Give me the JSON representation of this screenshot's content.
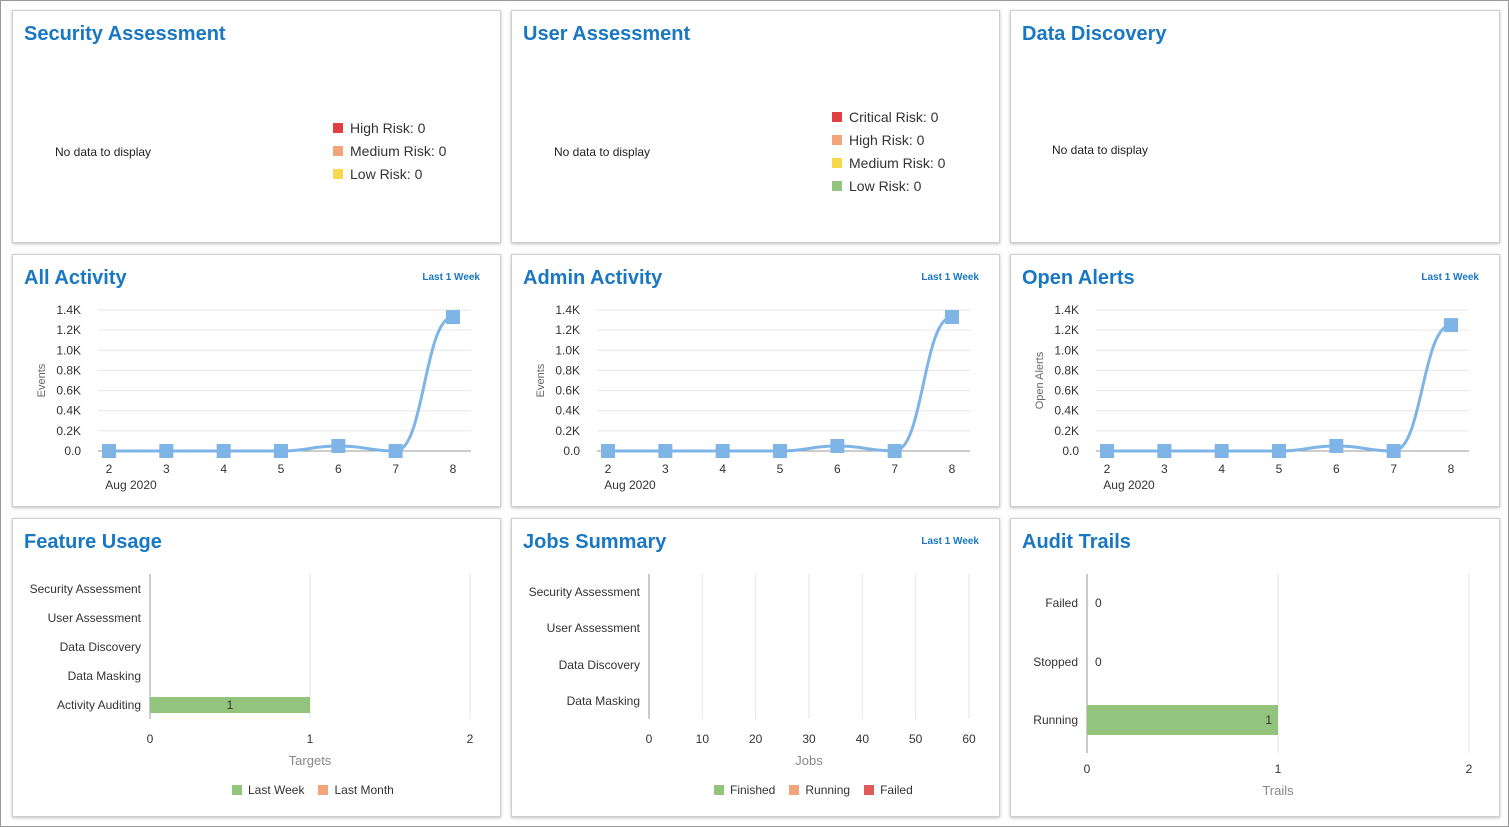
{
  "colors": {
    "title": "#1a77c2",
    "critical": "#e04040",
    "high_red": "#e04040",
    "high_orange": "#f2a47a",
    "medium": "#f7d94c",
    "low": "#93c47d",
    "line": "#7fb5e6",
    "bar": "#93c47d",
    "running": "#f2a47a",
    "failed": "#e05a5a"
  },
  "security_assessment": {
    "title": "Security Assessment",
    "no_data": "No data to display",
    "legend": [
      {
        "label": "High Risk: 0",
        "color": "#e04040"
      },
      {
        "label": "Medium Risk: 0",
        "color": "#f2a47a"
      },
      {
        "label": "Low Risk: 0",
        "color": "#f7d94c"
      }
    ]
  },
  "user_assessment": {
    "title": "User Assessment",
    "no_data": "No data to display",
    "legend": [
      {
        "label": "Critical Risk: 0",
        "color": "#e04040"
      },
      {
        "label": "High Risk: 0",
        "color": "#f2a47a"
      },
      {
        "label": "Medium Risk: 0",
        "color": "#f7d94c"
      },
      {
        "label": "Low Risk: 0",
        "color": "#93c47d"
      }
    ]
  },
  "data_discovery": {
    "title": "Data Discovery",
    "no_data": "No data to display"
  },
  "all_activity": {
    "title": "All Activity",
    "range": "Last 1 Week"
  },
  "admin_activity": {
    "title": "Admin Activity",
    "range": "Last 1 Week"
  },
  "open_alerts": {
    "title": "Open Alerts",
    "range": "Last 1 Week"
  },
  "feature_usage": {
    "title": "Feature Usage",
    "legend": [
      {
        "label": "Last Week",
        "color": "#93c47d"
      },
      {
        "label": "Last Month",
        "color": "#f2a47a"
      }
    ]
  },
  "jobs_summary": {
    "title": "Jobs Summary",
    "range": "Last 1 Week",
    "legend": [
      {
        "label": "Finished",
        "color": "#93c47d"
      },
      {
        "label": "Running",
        "color": "#f2a47a"
      },
      {
        "label": "Failed",
        "color": "#e05a5a"
      }
    ]
  },
  "audit_trails": {
    "title": "Audit Trails"
  },
  "chart_data": [
    {
      "id": "all_activity",
      "type": "line",
      "ylabel": "Events",
      "x": [
        "2",
        "3",
        "4",
        "5",
        "6",
        "7",
        "8"
      ],
      "x_sublabel": "Aug 2020",
      "series": [
        {
          "values": [
            0,
            0,
            0,
            0,
            50,
            0,
            1330
          ]
        }
      ],
      "ylim": [
        0,
        1400
      ],
      "yticks": [
        "0.0",
        "0.2K",
        "0.4K",
        "0.6K",
        "0.8K",
        "1.0K",
        "1.2K",
        "1.4K"
      ],
      "grid": true
    },
    {
      "id": "admin_activity",
      "type": "line",
      "ylabel": "Events",
      "x": [
        "2",
        "3",
        "4",
        "5",
        "6",
        "7",
        "8"
      ],
      "x_sublabel": "Aug 2020",
      "series": [
        {
          "values": [
            0,
            0,
            0,
            0,
            50,
            0,
            1330
          ]
        }
      ],
      "ylim": [
        0,
        1400
      ],
      "yticks": [
        "0.0",
        "0.2K",
        "0.4K",
        "0.6K",
        "0.8K",
        "1.0K",
        "1.2K",
        "1.4K"
      ],
      "grid": true
    },
    {
      "id": "open_alerts",
      "type": "line",
      "ylabel": "Open Alerts",
      "x": [
        "2",
        "3",
        "4",
        "5",
        "6",
        "7",
        "8"
      ],
      "x_sublabel": "Aug 2020",
      "series": [
        {
          "values": [
            0,
            0,
            0,
            0,
            50,
            0,
            1250
          ]
        }
      ],
      "ylim": [
        0,
        1400
      ],
      "yticks": [
        "0.0",
        "0.2K",
        "0.4K",
        "0.6K",
        "0.8K",
        "1.0K",
        "1.2K",
        "1.4K"
      ],
      "grid": true
    },
    {
      "id": "feature_usage",
      "type": "bar",
      "orientation": "horizontal",
      "categories": [
        "Security Assessment",
        "User Assessment",
        "Data Discovery",
        "Data Masking",
        "Activity Auditing"
      ],
      "series": [
        {
          "name": "Last Week",
          "values": [
            0,
            0,
            0,
            0,
            1
          ]
        },
        {
          "name": "Last Month",
          "values": [
            0,
            0,
            0,
            0,
            0
          ]
        }
      ],
      "data_labels": [
        "",
        "",
        "",
        "",
        "1"
      ],
      "xlabel": "Targets",
      "xlim": [
        0,
        2
      ],
      "xticks": [
        "0",
        "1",
        "2"
      ],
      "legend": "bottom"
    },
    {
      "id": "jobs_summary",
      "type": "bar",
      "orientation": "horizontal",
      "categories": [
        "Security Assessment",
        "User Assessment",
        "Data Discovery",
        "Data Masking"
      ],
      "series": [
        {
          "name": "Finished",
          "values": [
            0,
            0,
            0,
            0
          ]
        },
        {
          "name": "Running",
          "values": [
            0,
            0,
            0,
            0
          ]
        },
        {
          "name": "Failed",
          "values": [
            0,
            0,
            0,
            0
          ]
        }
      ],
      "xlabel": "Jobs",
      "xlim": [
        0,
        60
      ],
      "xticks": [
        "0",
        "10",
        "20",
        "30",
        "40",
        "50",
        "60"
      ],
      "legend": "bottom"
    },
    {
      "id": "audit_trails",
      "type": "bar",
      "orientation": "horizontal",
      "categories": [
        "Failed",
        "Stopped",
        "Running"
      ],
      "series": [
        {
          "values": [
            0,
            0,
            1
          ]
        }
      ],
      "data_labels": [
        "0",
        "0",
        "1"
      ],
      "xlabel": "Trails",
      "xlim": [
        0,
        2
      ],
      "xticks": [
        "0",
        "1",
        "2"
      ]
    }
  ]
}
